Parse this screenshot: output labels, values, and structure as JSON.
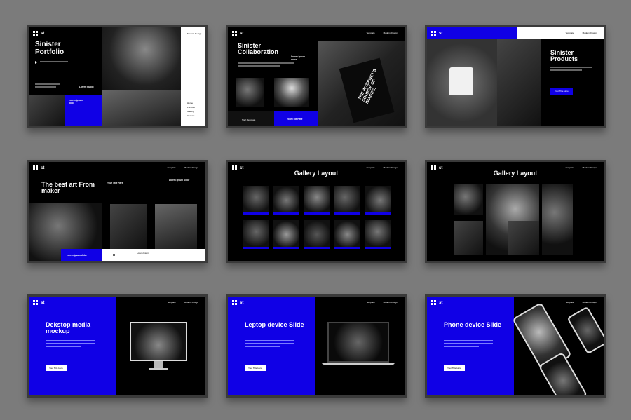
{
  "logo_text": "st",
  "slides": {
    "s1": {
      "title": "Sinister Portfolio",
      "nav": [
        "Modern Design"
      ],
      "side_items": [
        "Home",
        "Portfolio",
        "Gallery",
        "Contact"
      ],
      "blue_text": "Lorem ipsum dolor",
      "label": "Lorem Studio"
    },
    "s2": {
      "title": "Sinister Collaboration",
      "sub": "Lorem ipsum dolor",
      "nav": [
        "Template",
        "Modern Design"
      ],
      "bag_text": "THE INTERNET'S SOURCE OF IMAGES.",
      "btn1": "Start Template",
      "btn2": "Your Title Here"
    },
    "s3": {
      "title": "Sinister Products",
      "nav": [
        "Template",
        "Modern Design"
      ],
      "btn": "Your Title Here"
    },
    "s4": {
      "title": "The best art From maker",
      "nav": [
        "Template",
        "Modern Design"
      ],
      "right_head": "Lorem ipsum Dolor",
      "caption": "Your Title Here",
      "bar_text": "Lorem Ipsum",
      "btn": "Lorem ipsum dolor"
    },
    "s5": {
      "title": "Gallery Layout",
      "nav": [
        "Template",
        "Modern Design"
      ]
    },
    "s6": {
      "title": "Gallery Layout",
      "nav": [
        "Template",
        "Modern Design"
      ]
    },
    "s7": {
      "title": "Dekstop media mockup",
      "nav": [
        "Template",
        "Modern Design"
      ],
      "btn": "Your Title Here"
    },
    "s8": {
      "title": "Leptop device Slide",
      "nav": [
        "Template",
        "Modern Design"
      ],
      "btn": "Your Title Here"
    },
    "s9": {
      "title": "Phone device Slide",
      "nav": [
        "Template",
        "Modern Design"
      ],
      "btn": "Your Title Here"
    }
  }
}
